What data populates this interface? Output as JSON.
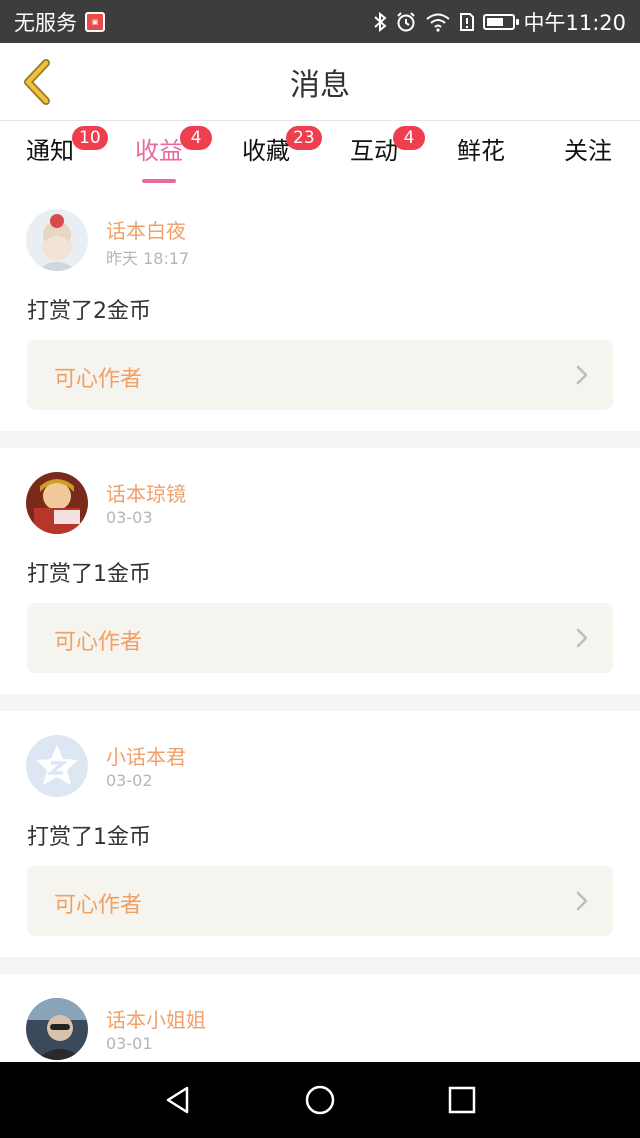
{
  "status_bar": {
    "carrier": "无服务",
    "sim_icon": "sim-alert-icon",
    "icons": [
      "bluetooth-icon",
      "alarm-icon",
      "wifi-icon",
      "sim-alert-icon",
      "battery-icon"
    ],
    "time": "中午11:20"
  },
  "header": {
    "title": "消息",
    "back_icon": "back-chevron-icon",
    "back_color": "#f0c23c"
  },
  "tabs": [
    {
      "label": "通知",
      "badge": "10",
      "active": false
    },
    {
      "label": "收益",
      "badge": "4",
      "active": true
    },
    {
      "label": "收藏",
      "badge": "23",
      "active": false
    },
    {
      "label": "互动",
      "badge": "4",
      "active": false
    },
    {
      "label": "鲜花",
      "badge": "",
      "active": false
    },
    {
      "label": "关注",
      "badge": "",
      "active": false
    }
  ],
  "colors": {
    "accent_pink": "#e86aa0",
    "badge_red": "#ef3f4f",
    "name_orange": "#f2a06a",
    "pill_bg": "#f6f4ee"
  },
  "items": [
    {
      "name": "话本白夜",
      "time": "昨天 18:17",
      "message": "打赏了2金币",
      "action": "可心作者",
      "avatar": "avatar-girl-photo"
    },
    {
      "name": "话本琼镜",
      "time": "03-03",
      "message": "打赏了1金币",
      "action": "可心作者",
      "avatar": "avatar-character-photo"
    },
    {
      "name": "小话本君",
      "time": "03-02",
      "message": "打赏了1金币",
      "action": "可心作者",
      "avatar": "avatar-default-star"
    },
    {
      "name": "话本小姐姐",
      "time": "03-01",
      "message": "",
      "action": "",
      "avatar": "avatar-selfie-photo"
    }
  ],
  "nav": [
    "back-triangle-icon",
    "home-circle-icon",
    "recents-square-icon"
  ]
}
